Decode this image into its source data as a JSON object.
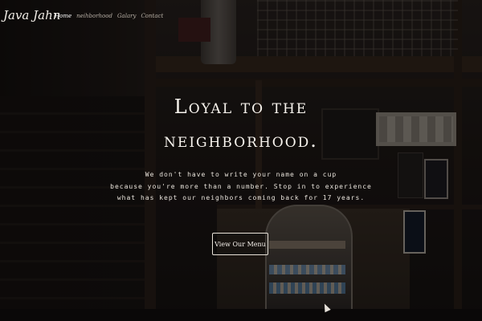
{
  "brand": "Java Jahn",
  "nav": {
    "items": [
      {
        "label": "Home",
        "active": true
      },
      {
        "label": "neihborhood",
        "active": false
      },
      {
        "label": "Galary",
        "active": false
      },
      {
        "label": "Contact",
        "active": false
      }
    ]
  },
  "hero": {
    "headline_line1": "Loyal to the",
    "headline_line2": "neighborhood.",
    "tagline_line1": "We don't have to write your name on a cup",
    "tagline_line2": "because you're more than a number. Stop in to experience",
    "tagline_line3": "what has kept our neighbors coming back for 17 years.",
    "cta_label": "View Our Menu"
  },
  "icons": {
    "cursor": "cursor-arrow-icon"
  }
}
